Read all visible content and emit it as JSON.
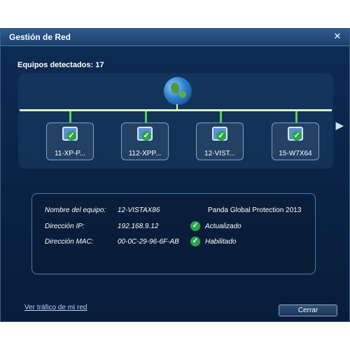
{
  "window": {
    "title": "Gestión de Red",
    "close_symbol": "✕"
  },
  "network": {
    "detected_label": "Equipos detectados: 17",
    "nodes": [
      {
        "label": "11-XP-P..."
      },
      {
        "label": "112-XPP..."
      },
      {
        "label": "12-VIST..."
      },
      {
        "label": "15-W7X64"
      }
    ],
    "next_arrow": "▶"
  },
  "details": {
    "labels": {
      "name": "Nombre del equipo:",
      "ip": "Dirección IP:",
      "mac": "Dirección MAC:"
    },
    "values": {
      "name": "12-VISTAX86",
      "ip": "192.168.9.12",
      "mac": "00-0C-29-96-6F-AB"
    },
    "product": "Panda Global Protection 2013",
    "statuses": [
      {
        "text": "Actualizado",
        "icon": "check-icon"
      },
      {
        "text": "Habilitado",
        "icon": "check-icon"
      }
    ]
  },
  "footer": {
    "link_text": "Ver tráfico de mi red",
    "close_button": "Cerrar"
  },
  "colors": {
    "window_bg": "#0a2447",
    "accent_green": "#58d056",
    "status_green": "#2ca54a"
  }
}
